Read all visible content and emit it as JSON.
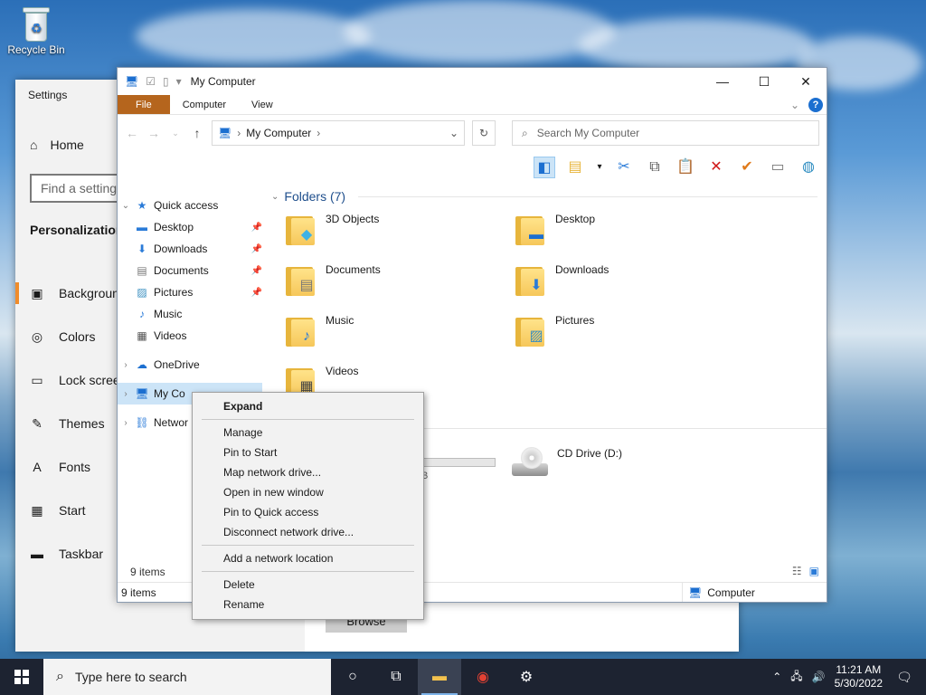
{
  "desktop": {
    "recycle_bin_label": "Recycle Bin"
  },
  "settings": {
    "title": "Settings",
    "home_label": "Home",
    "find_placeholder": "Find a setting",
    "section_title": "Personalization",
    "nav_items": [
      {
        "label": "Background",
        "icon": "image-icon"
      },
      {
        "label": "Colors",
        "icon": "palette-icon"
      },
      {
        "label": "Lock screen",
        "icon": "lock-screen-icon"
      },
      {
        "label": "Themes",
        "icon": "themes-icon"
      },
      {
        "label": "Fonts",
        "icon": "fonts-icon"
      },
      {
        "label": "Start",
        "icon": "start-icon"
      },
      {
        "label": "Taskbar",
        "icon": "taskbar-icon"
      }
    ],
    "browse_label": "Browse"
  },
  "explorer": {
    "title": "My Computer",
    "tabs": {
      "file": "File",
      "computer": "Computer",
      "view": "View"
    },
    "address": "My Computer",
    "search_placeholder": "Search My Computer",
    "nav": {
      "quick_access": "Quick access",
      "desktop": "Desktop",
      "downloads": "Downloads",
      "documents": "Documents",
      "pictures": "Pictures",
      "music": "Music",
      "videos": "Videos",
      "onedrive": "OneDrive",
      "my_computer": "My Co",
      "network": "Networ"
    },
    "folders_header": "Folders (7)",
    "folders": [
      "3D Objects",
      "Desktop",
      "Documents",
      "Downloads",
      "Music",
      "Pictures",
      "Videos"
    ],
    "drive_partial_text": "B",
    "cd_drive": "CD Drive (D:)",
    "item_count": "9 items",
    "status_count": "9 items",
    "status_location": "Computer"
  },
  "context_menu": {
    "expand": "Expand",
    "group1": [
      "Manage",
      "Pin to Start",
      "Map network drive...",
      "Open in new window",
      "Pin to Quick access",
      "Disconnect network drive..."
    ],
    "add_network_location": "Add a network location",
    "group3": [
      "Delete",
      "Rename"
    ]
  },
  "taskbar": {
    "search_placeholder": "Type here to search",
    "time": "11:21 AM",
    "date": "5/30/2022"
  },
  "colors": {
    "file_tab": "#b5651d",
    "accent": "#1c6fd0",
    "selection": "#cce4f7",
    "taskbar": "#1d2331"
  }
}
